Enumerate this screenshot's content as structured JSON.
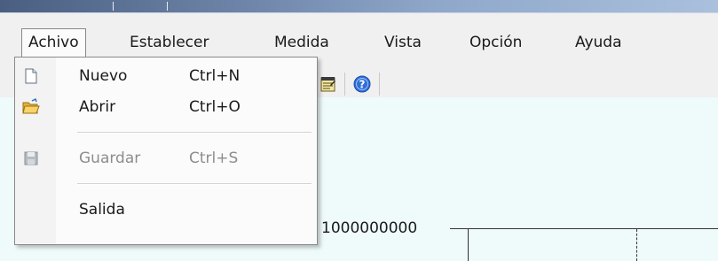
{
  "menubar": {
    "items": [
      {
        "label": "Achivo",
        "active": true
      },
      {
        "label": "Establecer"
      },
      {
        "label": "Medida"
      },
      {
        "label": "Vista"
      },
      {
        "label": "Opción"
      },
      {
        "label": "Ayuda"
      }
    ]
  },
  "file_menu": {
    "items": [
      {
        "label": "Nuevo",
        "shortcut": "Ctrl+N",
        "icon": "new-document-icon",
        "enabled": true
      },
      {
        "label": "Abrir",
        "shortcut": "Ctrl+O",
        "icon": "open-folder-icon",
        "enabled": true
      },
      {
        "label": "Guardar",
        "shortcut": "Ctrl+S",
        "icon": "save-disk-icon",
        "enabled": false
      },
      {
        "label": "Salida",
        "shortcut": "",
        "icon": "",
        "enabled": true
      }
    ]
  },
  "toolbar": {
    "icons": [
      "measurement-settings-icon",
      "help-icon"
    ]
  },
  "chart": {
    "y_tick_label": "1000000000"
  },
  "colors": {
    "workarea_bg": "#effbfb",
    "menu_bg": "#fbfbfb",
    "help_icon": "#2f6fd6"
  }
}
